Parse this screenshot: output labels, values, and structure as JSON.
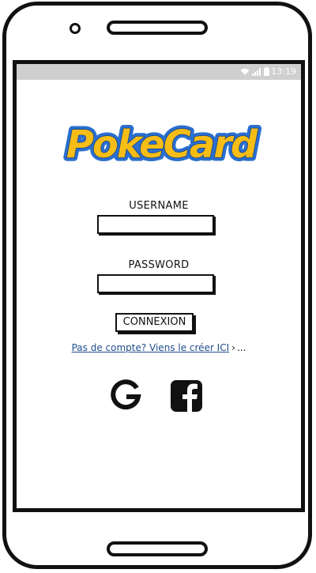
{
  "status_bar": {
    "time": "13:19",
    "icons": [
      "wifi-icon",
      "signal-icon",
      "battery-icon"
    ]
  },
  "logo": {
    "text": "PokeCard",
    "fill_color": "#f6bd16",
    "outline_color": "#2a6fd0"
  },
  "form": {
    "username_label": "USERNAME",
    "username_value": "",
    "password_label": "PASSWORD",
    "password_value": "",
    "submit_label": "CONNEXION"
  },
  "signup": {
    "link_text": "Pas de compte? Viens le créer ICI",
    "chevron": "›",
    "trailing": "..."
  },
  "social": [
    "google-icon",
    "facebook-icon"
  ]
}
